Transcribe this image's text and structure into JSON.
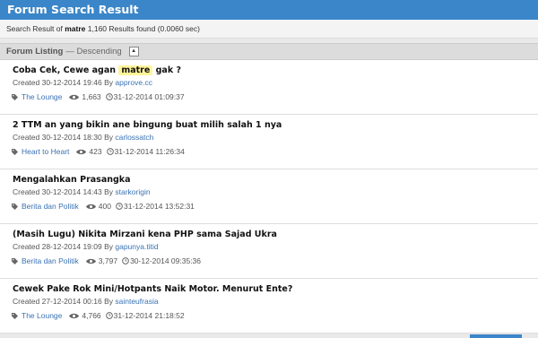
{
  "header": {
    "title": "Forum Search Result"
  },
  "summary": {
    "prefix": "Search Result of",
    "query": "matre",
    "count_text": "1,160 Results found (0.0060 sec)"
  },
  "listing": {
    "label": "Forum Listing",
    "mode": "— Descending",
    "toggle_glyph": "▲"
  },
  "results": [
    {
      "title_before": "Coba Cek, Cewe agan ",
      "highlight": "matre",
      "title_after": " gak ?",
      "created": "Created 30-12-2014 19:46 By",
      "author": "approve.cc",
      "category": "The Lounge",
      "views": "1,663",
      "last": "31-12-2014 01:09:37"
    },
    {
      "title_before": "2 TTM an yang bikin ane bingung buat milih salah 1 nya",
      "highlight": "",
      "title_after": "",
      "created": "Created 30-12-2014 18:30 By",
      "author": "carlossatch",
      "category": "Heart to Heart",
      "views": "423",
      "last": "31-12-2014 11:26:34"
    },
    {
      "title_before": "Mengalahkan Prasangka",
      "highlight": "",
      "title_after": "",
      "created": "Created 30-12-2014 14:43 By",
      "author": "starkorigin",
      "category": "Berita dan Politik",
      "views": "400",
      "last": "31-12-2014 13:52:31"
    },
    {
      "title_before": "(Masih Lugu) Nikita Mirzani kena PHP sama Sajad Ukra",
      "highlight": "",
      "title_after": "",
      "created": "Created 28-12-2014 19:09 By",
      "author": "gapunya.titid",
      "category": "Berita dan Politik",
      "views": "3,797",
      "last": "30-12-2014 09:35:36"
    },
    {
      "title_before": "Cewek Pake Rok Mini/Hotpants Naik Motor. Menurut Ente?",
      "highlight": "",
      "title_after": "",
      "created": "Created 27-12-2014 00:16 By",
      "author": "sainteufrasia",
      "category": "The Lounge",
      "views": "4,766",
      "last": "31-12-2014 21:18:52"
    }
  ]
}
